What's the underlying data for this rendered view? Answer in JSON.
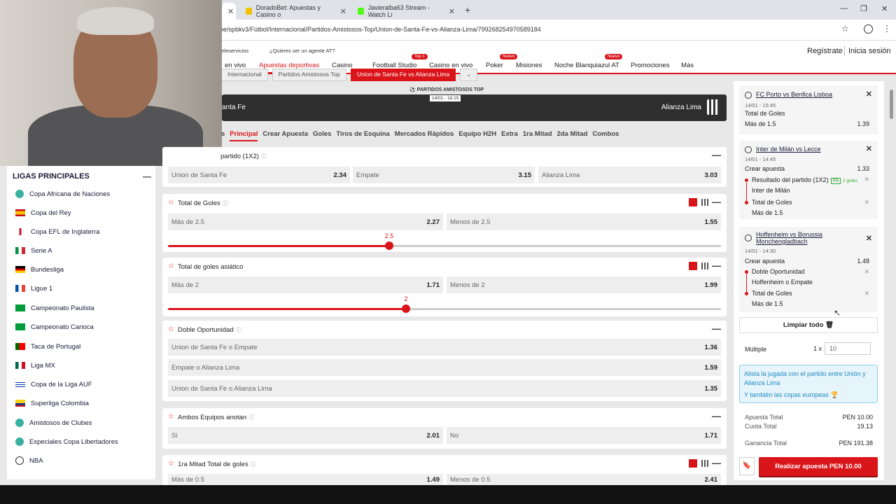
{
  "browser": {
    "tabs": [
      {
        "label": "DoradoBet: Apuestas y Casino o",
        "color": "#f2c200"
      },
      {
        "label": "Javieralba63 Stream - Watch Li",
        "color": "#53fc18"
      }
    ],
    "url": "pe/spbkv3/Fútbol/Internacional/Partidos-Amistosos-Top/Union-de-Santa-Fe-vs-Alianza-Lima/79926825497058918​4"
  },
  "site": {
    "services": "eleservicios",
    "agent": "¿Quieres ser un agente AT?",
    "register": "Regístrate",
    "login": "Inicia sesión",
    "nav": [
      {
        "label": "en vivo",
        "active": false,
        "badge": ""
      },
      {
        "label": "Apuestas deportivas",
        "active": true,
        "badge": ""
      },
      {
        "label": "Casino",
        "active": false,
        "badge": ""
      },
      {
        "label": "Football Studio",
        "active": false,
        "badge": "Top 1"
      },
      {
        "label": "Casino en vivo",
        "active": false,
        "badge": ""
      },
      {
        "label": "Poker",
        "active": false,
        "badge": "Nuevo"
      },
      {
        "label": "Misiones",
        "active": false,
        "badge": ""
      },
      {
        "label": "Noche Blanquiazul AT",
        "active": false,
        "badge": "Nuevo"
      },
      {
        "label": "Promociones",
        "active": false,
        "badge": ""
      },
      {
        "label": "Más",
        "active": false,
        "badge": ""
      }
    ],
    "breadcrumbs": [
      "Internacional",
      "Partidos Amistosos Top",
      "Union de Santa Fe vs Alianza Lima"
    ]
  },
  "leagues": {
    "title": "LIGAS PRINCIPALES",
    "items": [
      {
        "label": "Copa Africana de Naciones",
        "icon": "globe-icon"
      },
      {
        "label": "Copa del Rey",
        "icon": "spain-flag-icon"
      },
      {
        "label": "Copa EFL de Inglaterra",
        "icon": "england-flag-icon"
      },
      {
        "label": "Serie A",
        "icon": "italy-flag-icon"
      },
      {
        "label": "Bundesliga",
        "icon": "germany-flag-icon"
      },
      {
        "label": "Ligue 1",
        "icon": "france-flag-icon"
      },
      {
        "label": "Campeonato Paulista",
        "icon": "brazil-flag-icon"
      },
      {
        "label": "Campeonato Carioca",
        "icon": "brazil-flag-icon"
      },
      {
        "label": "Taca de Portugal",
        "icon": "portugal-flag-icon"
      },
      {
        "label": "Liga MX",
        "icon": "mexico-flag-icon"
      },
      {
        "label": "Copa de la Liga AUF",
        "icon": "uruguay-flag-icon"
      },
      {
        "label": "Superliga Colombia",
        "icon": "colombia-flag-icon"
      },
      {
        "label": "Amistosos de Clubes",
        "icon": "globe-icon"
      },
      {
        "label": "Especiales Copa Libertadores",
        "icon": "globe-icon"
      },
      {
        "label": "NBA",
        "icon": "basketball-icon"
      }
    ]
  },
  "match": {
    "competition": "PARTIDOS AMISTOSOS TOP",
    "date": "14/01 - 16:15",
    "home": "anta Fe",
    "away": "Alianza Lima",
    "tabs": [
      "s",
      "Principal",
      "Crear Apuesta",
      "Goles",
      "Tiros de Esquina",
      "Mercados Rápidos",
      "Equipo H2H",
      "Extra",
      "1ra Mitad",
      "2da Mitad",
      "Combos"
    ]
  },
  "markets": {
    "m1": {
      "title": "partido (1X2)",
      "o1": "Union de Santa Fe",
      "v1": "2.34",
      "o2": "Empate",
      "v2": "3.15",
      "o3": "Alianza Lima",
      "v3": "3.03"
    },
    "m2": {
      "title": "Total de Goles",
      "o1": "Más de 2.5",
      "v1": "2.27",
      "o2": "Menos de 2.5",
      "v2": "1.55",
      "line": "2.5"
    },
    "m3": {
      "title": "Total de goles asiático",
      "o1": "Más de 2",
      "v1": "1.71",
      "o2": "Menos de 2",
      "v2": "1.99",
      "line": "2"
    },
    "m4": {
      "title": "Doble Oportunidad",
      "o1": "Union de Santa Fe o Empate",
      "v1": "1.36",
      "o2": "Empate o Alianza Lima",
      "v2": "1.59",
      "o3": "Union de Santa Fe o Alianza Lima",
      "v3": "1.35"
    },
    "m5": {
      "title": "Ambos Equipos anotan",
      "o1": "Si",
      "v1": "2.01",
      "o2": "No",
      "v2": "1.71"
    },
    "m6": {
      "title": "1ra Mitad Total de goles",
      "o1": "Más de 0.5",
      "v1": "1.49",
      "o2": "Menos de 0.5",
      "v2": "2.41"
    }
  },
  "slider_levels": {
    "total_goles": 0.4,
    "asiatico": 0.43
  },
  "betslip": {
    "s1": {
      "match": "FC Porto vs Benfica Lisboa",
      "date": "14/01 - 15:45",
      "market": "Total de Goles",
      "pick": "Más de 1.5",
      "odds": "1.39"
    },
    "s2": {
      "match": "Inter de Milán vs Lecce",
      "date": "14/01 - 14:45",
      "type": "Crear apuesta",
      "odds": "1.33",
      "l1": "Resultado del partido (1X2)",
      "pa": "PA",
      "pa_note": "2 goles",
      "l1v": "Inter de Milán",
      "l2": "Total de Goles",
      "l2v": "Más de 1.5"
    },
    "s3": {
      "match1": "Hoffenheim vs Borussia",
      "match2": "Monchengladbach",
      "date": "14/01 - 14:30",
      "type": "Crear apuesta",
      "odds": "1.48",
      "l1": "Doble Oportunidad",
      "l1v": "Hoffenheim o Empate",
      "l2": "Total de Goles",
      "l2v": "Más de 1.5"
    },
    "clear": "Limpiar todo",
    "multiple": "Múltiple",
    "mult_x": "1 x",
    "stake": "10",
    "promo1": "Alista la jugada con el partido entre Unión y Alianza Lima",
    "promo2": "Y también las copas europeas",
    "apuesta_total_label": "Apuesta Total",
    "apuesta_total": "PEN 10.00",
    "cuota_total_label": "Cuota Total",
    "cuota_total": "19.13",
    "ganancia_label": "Ganancia Total",
    "ganancia": "PEN 191.38",
    "place": "Realizar apuesta PEN 10.00"
  }
}
